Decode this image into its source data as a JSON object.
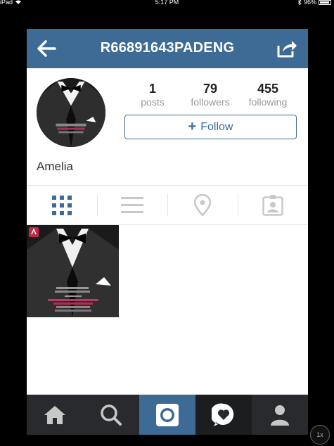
{
  "status_bar": {
    "device": "iPad",
    "time": "5:17 PM",
    "battery_percent": "96%",
    "battery_level": 0.96
  },
  "header": {
    "title": "R66891643PADENG",
    "back_icon": "arrow-left-icon",
    "share_icon": "share-icon"
  },
  "profile": {
    "name": "Amelia",
    "stats": [
      {
        "value": "1",
        "label": "posts"
      },
      {
        "value": "79",
        "label": "followers"
      },
      {
        "value": "455",
        "label": "following"
      }
    ],
    "follow_plus": "+",
    "follow_label": "Follow"
  },
  "tabs": [
    {
      "icon": "grid-icon",
      "active": true
    },
    {
      "icon": "list-icon",
      "active": false
    },
    {
      "icon": "location-pin-icon",
      "active": false
    },
    {
      "icon": "tagged-photos-icon",
      "active": false
    }
  ],
  "bottom_bar": [
    {
      "icon": "home-icon"
    },
    {
      "icon": "search-icon"
    },
    {
      "icon": "camera-icon",
      "active": true
    },
    {
      "icon": "activity-heart-icon"
    },
    {
      "icon": "profile-icon"
    }
  ],
  "zoom_label": "1x",
  "colors": {
    "accent": "#3e6b96",
    "tabbar": "#282a2d",
    "inactive_icon": "#c8c8c8"
  }
}
